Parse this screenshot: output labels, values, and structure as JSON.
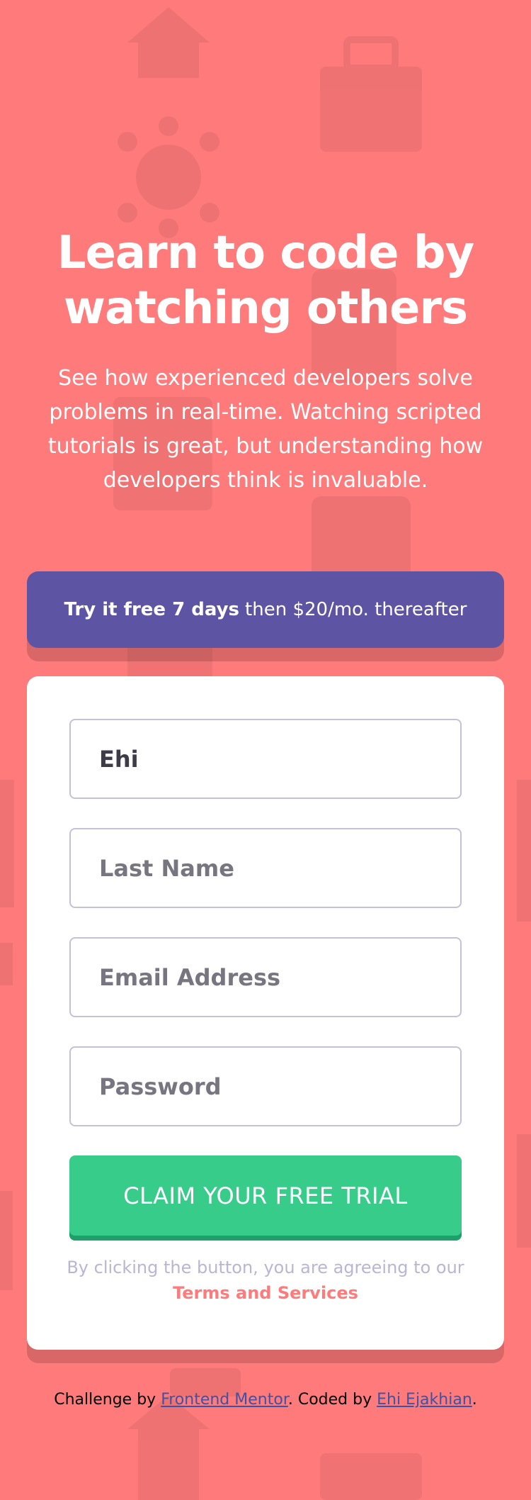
{
  "hero": {
    "title_line1": "Learn to code by",
    "title_line2": "watching others",
    "description": "See how experienced developers solve problems in real-time. Watching scripted tutorials is great, but understanding how developers think is invaluable."
  },
  "banner": {
    "bold": "Try it free 7 days",
    "rest": "then $20/mo. thereafter"
  },
  "form": {
    "first_name_value": "Ehi",
    "last_name_placeholder": "Last Name",
    "email_placeholder": "Email Address",
    "password_placeholder": "Password",
    "submit_label": "CLAIM YOUR FREE TRIAL",
    "terms_text": "By clicking the button, you are agreeing to our",
    "terms_link": "Terms and Services"
  },
  "footer": {
    "prefix": "Challenge by",
    "mentor_link": "Frontend Mentor",
    "middle": ". Coded by",
    "author_link": "Ehi Ejakhian",
    "suffix": "."
  },
  "colors": {
    "background": "#ff7a7a",
    "banner": "#5e54a4",
    "button": "#38cc8b",
    "terms_link": "#ff7a7a"
  }
}
